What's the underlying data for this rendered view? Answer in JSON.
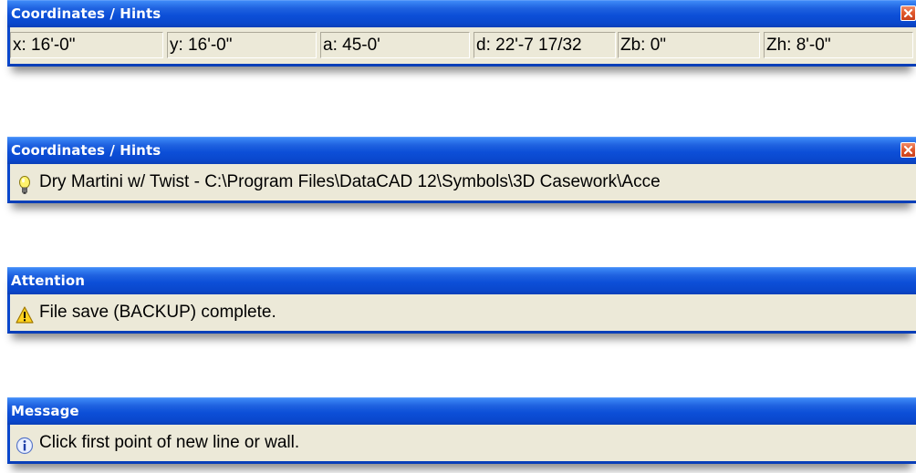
{
  "panels": [
    {
      "title": "Coordinates / Hints",
      "has_close": true,
      "cells": [
        "x: 16'-0\"",
        "y: 16'-0\"",
        "a: 45-0'",
        "d: 22'-7 17/32",
        "Zb: 0\"",
        "Zh: 8'-0\""
      ]
    },
    {
      "title": "Coordinates / Hints",
      "has_close": true,
      "icon": "lightbulb-icon",
      "text": "Dry Martini w/ Twist - C:\\Program Files\\DataCAD 12\\Symbols\\3D Casework\\Acce"
    },
    {
      "title": "Attention",
      "has_close": false,
      "icon": "warning-icon",
      "text": "File save (BACKUP) complete."
    },
    {
      "title": "Message",
      "has_close": false,
      "icon": "info-icon",
      "text": "Click first point of new line or wall."
    }
  ],
  "colors": {
    "titlebar": "#0a47cc",
    "body": "#ece9d8",
    "close_button": "#e25a2e"
  }
}
